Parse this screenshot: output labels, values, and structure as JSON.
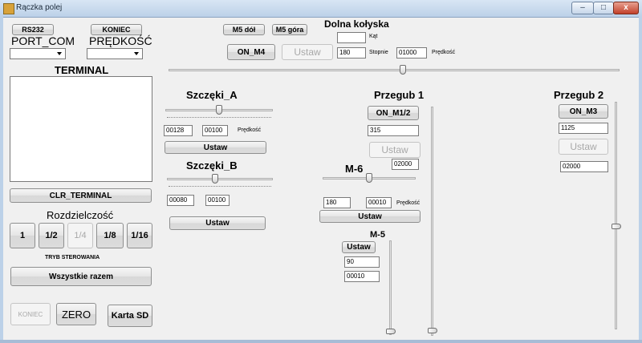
{
  "window": {
    "title": "Rączka polej",
    "minimize_label": "–",
    "maximize_label": "□",
    "close_label": "x"
  },
  "left": {
    "rs232_label": "RS232",
    "koniec_top_label": "KONIEC",
    "port_com_label": "PORT_COM",
    "predkosc_label": "PRĘDKOŚĆ",
    "port_com_value": "",
    "predkosc_value": "",
    "terminal_label": "TERMINAL",
    "terminal_content": "",
    "clr_terminal_label": "CLR_TERMINAL",
    "rozdzielczosc_label": "Rozdzielczość",
    "res_buttons": [
      "1",
      "1/2",
      "1/4",
      "1/8",
      "1/16"
    ],
    "tryb_label": "TRYB STEROWANIA",
    "wszystkie_label": "Wszystkie razem",
    "koniec_bottom_label": "KONIEC",
    "zero_label": "ZERO",
    "karta_sd_label": "Karta SD"
  },
  "kolyska": {
    "m5_dol_label": "M5 dół",
    "m5_gora_label": "M5 góra",
    "title": "Dolna kołyska",
    "kat_label": "Kąt",
    "kat_value": "",
    "on_m4_label": "ON_M4",
    "ustaw_label": "Ustaw",
    "stopnie_value": "180",
    "stopnie_label": "Stopnie",
    "predkosc_value": "01000",
    "predkosc_label": "Prędkość",
    "slider_value": 0.52
  },
  "szczeki_a": {
    "title": "Szczęki_A",
    "value1": "00128",
    "value2": "00100",
    "predkosc_label": "Prędkość",
    "ustaw_label": "Ustaw",
    "slider_value": 0.5
  },
  "szczeki_b": {
    "title": "Szczęki_B",
    "value1": "00080",
    "value2": "00100",
    "ustaw_label": "Ustaw",
    "slider_value": 0.45
  },
  "przegub1": {
    "title": "Przegub 1",
    "on_label": "ON_M1/2",
    "value1": "315",
    "ustaw_label": "Ustaw",
    "value2": "02000",
    "slider_value": 0.99
  },
  "m6": {
    "title": "M-6",
    "value1": "180",
    "value2": "00010",
    "predkosc_label": "Prędkość",
    "ustaw_label": "Ustaw",
    "slider_value": 0.5
  },
  "m5": {
    "title": "M-5",
    "ustaw_label": "Ustaw",
    "value1": "90",
    "value2": "00010",
    "slider_value": 0.99
  },
  "przegub2": {
    "title": "Przegub 2",
    "on_label": "ON_M3",
    "value1": "1125",
    "ustaw_label": "Ustaw",
    "value2": "02000",
    "slider_value": 0.55
  }
}
